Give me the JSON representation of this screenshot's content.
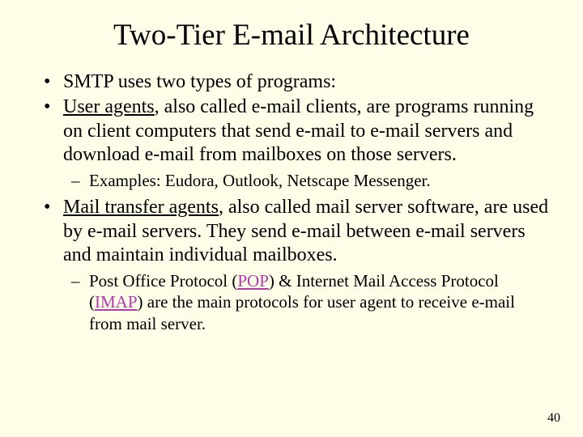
{
  "title": "Two-Tier E-mail Architecture",
  "bullets": {
    "b1": "SMTP uses two types of programs:",
    "b2_term": "User agents",
    "b2_rest": ", also called e-mail clients, are programs running on client computers that send e-mail to e-mail servers and download e-mail from mailboxes on those servers.",
    "b2_sub": "Examples: Eudora, Outlook, Netscape Messenger.",
    "b3_term": "Mail transfer agents",
    "b3_rest": ", also called mail server software, are used by e-mail servers. They send e-mail between e-mail servers and maintain individual mailboxes.",
    "b3_sub_a": "Post Office Protocol (",
    "b3_sub_pop": "POP",
    "b3_sub_b": ") & Internet Mail Access Protocol (",
    "b3_sub_imap": "IMAP",
    "b3_sub_c": ") are the main protocols for user agent to receive e-mail from mail server."
  },
  "page_number": "40"
}
